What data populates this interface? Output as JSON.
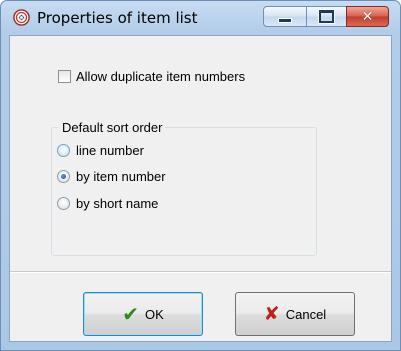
{
  "window": {
    "title": "Properties of item list",
    "icon": "app-gear-icon"
  },
  "titlebar_buttons": {
    "minimize": "minimize-icon",
    "maximize": "maximize-icon",
    "close": "close-icon",
    "close_glyph": "✕"
  },
  "options": {
    "allow_duplicates_label": "Allow duplicate item numbers",
    "allow_duplicates_checked": false
  },
  "sort_order": {
    "group_label": "Default sort order",
    "items": [
      {
        "label": "line number",
        "selected": false
      },
      {
        "label": "by item number",
        "selected": true
      },
      {
        "label": "by short name",
        "selected": false
      }
    ]
  },
  "buttons": {
    "ok_label": "OK",
    "ok_icon": "checkmark-icon",
    "ok_glyph": "✔",
    "cancel_label": "Cancel",
    "cancel_icon": "red-x-icon",
    "cancel_glyph": "✘"
  },
  "colors": {
    "frame": "#b3cde9",
    "close_button": "#c23d2b",
    "ok_check": "#2d8a1a",
    "cancel_x": "#c0201a"
  }
}
